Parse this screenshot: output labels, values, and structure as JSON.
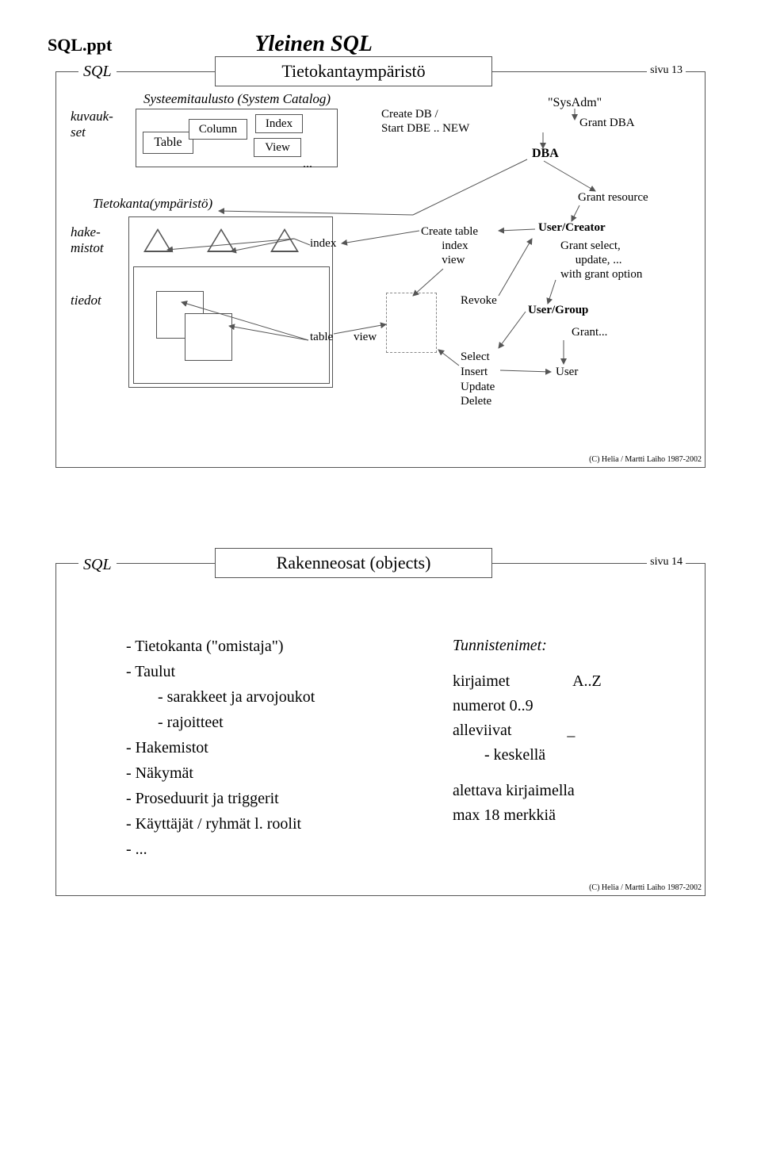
{
  "header": {
    "doc": "SQL.ppt",
    "title": "Yleinen SQL"
  },
  "slide1": {
    "sql": "SQL",
    "boxtitle": "Tietokantaympäristö",
    "sivu": "sivu 13",
    "systitle": "Systeemitaulusto (System Catalog)",
    "kuvaukset_l1": "kuvauk-",
    "kuvaukset_l2": "set",
    "Table": "Table",
    "Column": "Column",
    "Index": "Index",
    "View": "View",
    "dots": "...",
    "createDB_l1": "Create DB /",
    "createDB_l2": "Start DBE .. NEW",
    "SysAdm": "\"SysAdm\"",
    "GrantDBA": "Grant DBA",
    "DBA": "DBA",
    "GrantResource": "Grant resource",
    "TietoEnv": "Tietokanta(ympäristö)",
    "hakemistot_l1": "hake-",
    "hakemistot_l2": "mistot",
    "tiedot": "tiedot",
    "index": "index",
    "table": "table",
    "view": "view",
    "createTable_l1": "Create table",
    "createTable_l2": "index",
    "createTable_l3": "view",
    "Revoke": "Revoke",
    "Select": "Select",
    "Insert": "Insert",
    "Update": "Update",
    "Delete": "Delete",
    "UserCreator": "User/Creator",
    "GrantSelect_l1": "Grant select,",
    "GrantSelect_l2": "update, ...",
    "GrantSelect_l3": "with grant option",
    "UserGroup": "User/Group",
    "GrantDots": "Grant...",
    "User": "User",
    "copyright": "(C) Helia / Martti Laiho 1987-2002"
  },
  "slide2": {
    "sql": "SQL",
    "boxtitle": "Rakenneosat (objects)",
    "sivu": "sivu 14",
    "l1": "- Tietokanta (\"omistaja\")",
    "l2": "- Taulut",
    "l2a": "- sarakkeet ja arvojoukot",
    "l2b": "- rajoitteet",
    "l3": "- Hakemistot",
    "l4": "- Näkymät",
    "l5": "- Proseduurit ja triggerit",
    "l6": "- Käyttäjät / ryhmät l. roolit",
    "l7": "- ...",
    "r_title": "Tunnistenimet:",
    "r_kirj": "kirjaimet",
    "r_kirj_v": "A..Z",
    "r_num": "numerot 0..9",
    "r_alle": "alleviivat",
    "r_alle_v": "_",
    "r_kesk": "- keskellä",
    "r_alett": "alettava kirjaimella",
    "r_max": "max 18 merkkiä",
    "copyright": "(C) Helia / Martti Laiho 1987-2002"
  }
}
